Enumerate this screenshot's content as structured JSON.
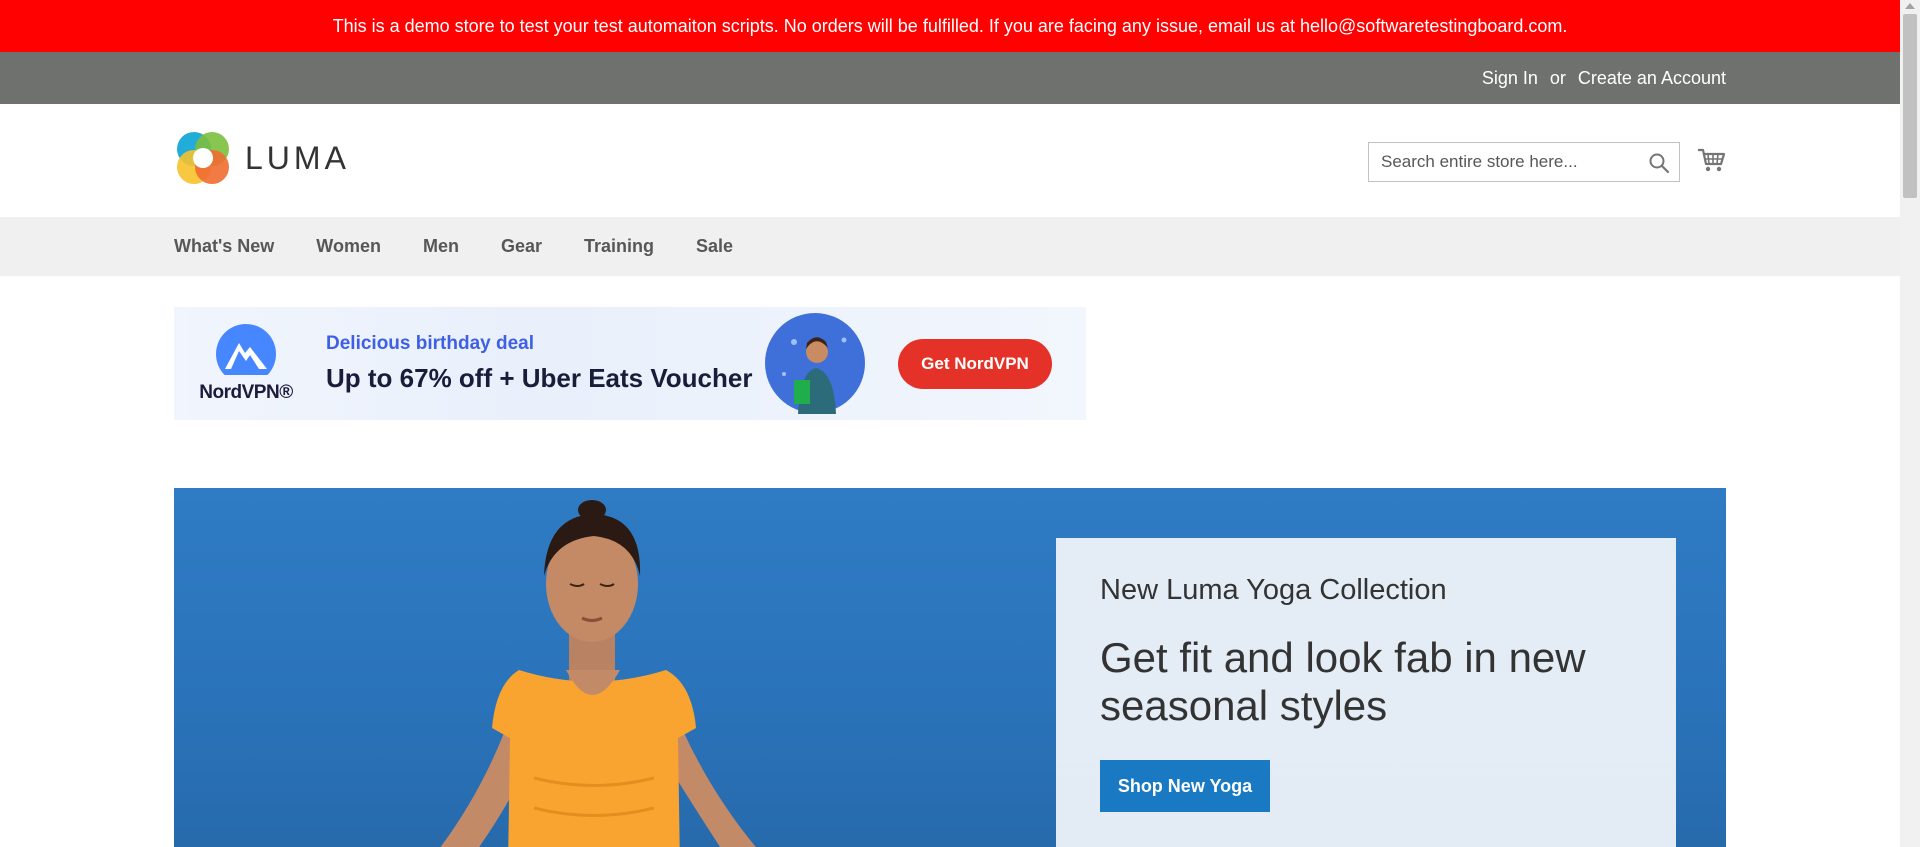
{
  "notice": {
    "text": "This is a demo store to test your test automaiton scripts. No orders will be fulfilled. If you are facing any issue, email us at hello@softwaretestingboard.com."
  },
  "toplinks": {
    "sign_in": "Sign In",
    "or": "or",
    "create_account": "Create an Account"
  },
  "header": {
    "logo_text": "LUMA",
    "search_placeholder": "Search entire store here...",
    "search_icon": "search-icon",
    "cart_icon": "cart-icon"
  },
  "nav": {
    "items": [
      {
        "label": "What's New"
      },
      {
        "label": "Women"
      },
      {
        "label": "Men"
      },
      {
        "label": "Gear"
      },
      {
        "label": "Training"
      },
      {
        "label": "Sale"
      }
    ]
  },
  "ad": {
    "brand": "NordVPN®",
    "subtitle": "Delicious birthday deal",
    "title": "Up to 67% off + Uber Eats Voucher",
    "cta": "Get NordVPN",
    "colors": {
      "cta": "#e53228",
      "subtitle": "#3e5fe6",
      "logo": "#4687ff"
    }
  },
  "hero": {
    "kicker": "New Luma Yoga Collection",
    "title": "Get fit and look fab in new seasonal styles",
    "button": "Shop New Yoga",
    "colors": {
      "background": "#2a73ba",
      "button": "#1979c3",
      "shirt": "#f9a431"
    }
  },
  "colors": {
    "notice_bar": "#ff0101",
    "toplinks_bar": "#6e716e",
    "nav_bar": "#f0f0f0"
  }
}
